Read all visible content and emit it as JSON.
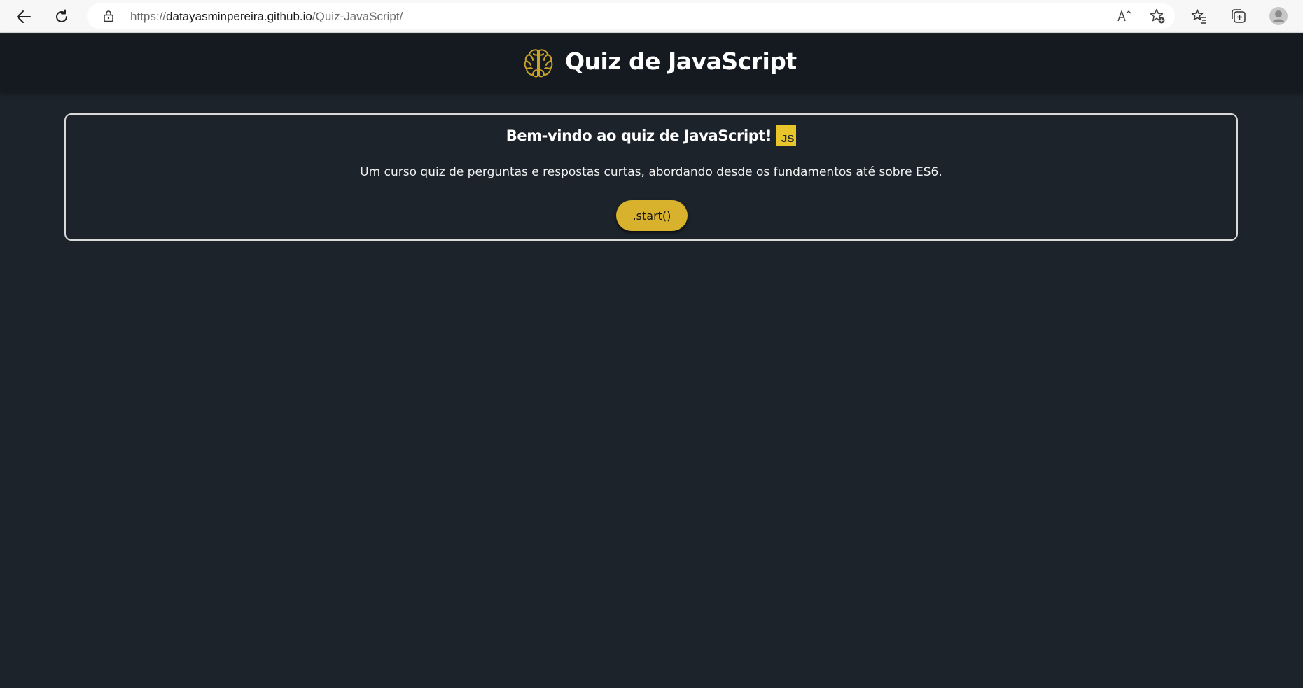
{
  "browser": {
    "url_prefix": "https://",
    "url_domain": "datayasminpereira.github.io",
    "url_path": "/Quiz-JavaScript/",
    "icons": [
      "back-arrow-icon",
      "reload-icon",
      "lock-icon",
      "read-aloud-icon",
      "add-favorite-icon",
      "favorites-icon",
      "collections-icon",
      "profile-icon"
    ]
  },
  "header": {
    "title": "Quiz de JavaScript",
    "icon": "brain-icon",
    "icon_color": "#c9a227",
    "background": "#141a1f"
  },
  "welcome": {
    "heading": "Bem-vindo ao quiz de JavaScript!",
    "badge": "JS",
    "badge_color": "#e8c52a",
    "description": "Um curso quiz de perguntas e respostas curtas, abordando desde os fundamentos até sobre ES6.",
    "start_label": ".start()",
    "start_color": "#d8b22c"
  },
  "page_background": "#1c232b"
}
